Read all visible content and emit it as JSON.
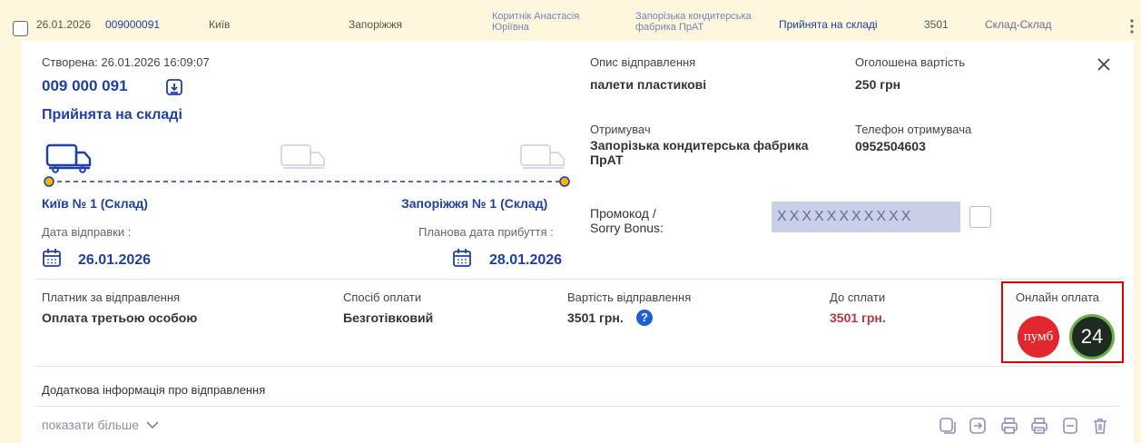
{
  "row": {
    "date": "26.01.2026",
    "number": "009000091",
    "from_city": "Київ",
    "to_city": "Запоріжжя",
    "sender_line1": "Коритнік Анастасія",
    "sender_line2": "Юріївна",
    "receiver_line1": "Запорізька кондитерська",
    "receiver_line2": "фабрика ПрАТ",
    "status": "Прийнята на складі",
    "cost": "3501",
    "route_type": "Склад-Склад"
  },
  "details": {
    "created": "Створена: 26.01.2026 16:09:07",
    "number": "009 000 091",
    "status": "Прийнята на складі",
    "origin": "Київ № 1 (Склад)",
    "destination": "Запоріжжя № 1 (Склад)",
    "send_date_label": "Дата відправки :",
    "send_date": "26.01.2026",
    "arrival_label": "Планова дата прибуття :",
    "arrival_date": "28.01.2026",
    "description_label": "Опис відправлення",
    "description": "палети пластикові",
    "declared_label": "Оголошена вартість",
    "declared": "250 грн",
    "recipient_label": "Отримувач",
    "recipient_line1": "Запорізька кондитерська фабрика",
    "recipient_line2": "ПрАТ",
    "phone_label": "Телефон отримувача",
    "phone": "0952504603",
    "promo_label_line1": "Промокод /",
    "promo_label_line2": "Sorry Bonus:",
    "promo_value": "XXXXXXXXXXX"
  },
  "payment": {
    "payer_label": "Платник за відправлення",
    "payer": "Оплата третьою особою",
    "method_label": "Спосіб оплати",
    "method": "Безготівковий",
    "cost_label": "Вартість відправлення",
    "cost": "3501 грн.",
    "due_label": "До сплати",
    "due": "3501 грн.",
    "online_label": "Онлайн оплата",
    "pumb_logo": "пумб",
    "p24_logo": "24"
  },
  "extra": {
    "info_label": "Додаткова інформація про відправлення",
    "show_more": "показати більше"
  },
  "colors": {
    "accent_blue": "#1f3fa6",
    "due_red": "#b2393b",
    "highlight_red": "#e00000",
    "pumb_red": "#e1262d",
    "p24_dark": "#1f2a22",
    "p24_green": "#6ab04c"
  }
}
